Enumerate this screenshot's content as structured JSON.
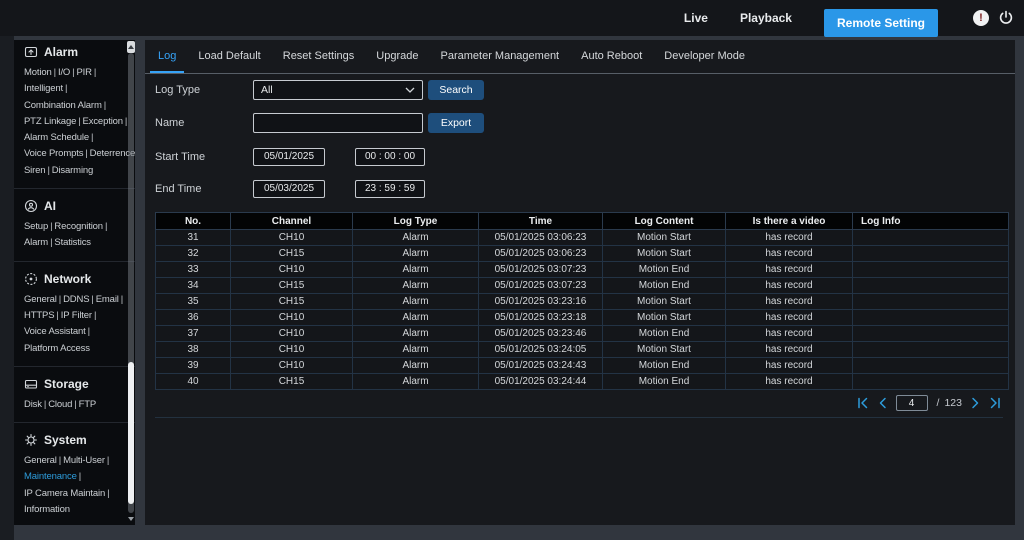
{
  "topbar": {
    "live": "Live",
    "playback": "Playback",
    "remote_setting": "Remote Setting",
    "alert_glyph": "!",
    "icons": [
      "alert-icon",
      "power-icon"
    ]
  },
  "sidebar": {
    "separator": "|",
    "active_item": "Maintenance",
    "sections": [
      {
        "title": "Alarm",
        "icon": "alarm-icon",
        "lines": [
          [
            "Motion",
            "I/O",
            "PIR"
          ],
          [
            "Intelligent"
          ],
          [
            "Combination Alarm"
          ],
          [
            "PTZ Linkage",
            "Exception"
          ],
          [
            "Alarm Schedule"
          ],
          [
            "Voice Prompts",
            "Deterrence"
          ],
          [
            "Siren",
            "Disarming"
          ]
        ]
      },
      {
        "title": "AI",
        "icon": "ai-icon",
        "lines": [
          [
            "Setup",
            "Recognition"
          ],
          [
            "Alarm",
            "Statistics"
          ]
        ]
      },
      {
        "title": "Network",
        "icon": "network-icon",
        "lines": [
          [
            "General",
            "DDNS",
            "Email"
          ],
          [
            "HTTPS",
            "IP Filter"
          ],
          [
            "Voice Assistant"
          ],
          [
            "Platform Access"
          ]
        ]
      },
      {
        "title": "Storage",
        "icon": "storage-icon",
        "lines": [
          [
            "Disk",
            "Cloud",
            "FTP"
          ]
        ]
      },
      {
        "title": "System",
        "icon": "system-icon",
        "lines": [
          [
            "General",
            "Multi-User"
          ],
          [
            "Maintenance"
          ],
          [
            "IP Camera Maintain"
          ],
          [
            "Information"
          ]
        ]
      }
    ]
  },
  "tabs": [
    {
      "label": "Log",
      "active": true
    },
    {
      "label": "Load Default",
      "active": false
    },
    {
      "label": "Reset Settings",
      "active": false
    },
    {
      "label": "Upgrade",
      "active": false
    },
    {
      "label": "Parameter Management",
      "active": false
    },
    {
      "label": "Auto Reboot",
      "active": false
    },
    {
      "label": "Developer Mode",
      "active": false
    }
  ],
  "filters": {
    "log_type_label": "Log Type",
    "log_type_value": "All",
    "search_button": "Search",
    "name_label": "Name",
    "name_value": "",
    "export_button": "Export",
    "start_time_label": "Start Time",
    "start_date": "05/01/2025",
    "start_time": "00 : 00 : 00",
    "end_time_label": "End Time",
    "end_date": "05/03/2025",
    "end_time": "23 : 59 : 59"
  },
  "log_table": {
    "columns": [
      "No.",
      "Channel",
      "Log Type",
      "Time",
      "Log Content",
      "Is there a video",
      "Log Info"
    ],
    "rows": [
      [
        "31",
        "CH10",
        "Alarm",
        "05/01/2025 03:06:23",
        "Motion Start",
        "has record",
        ""
      ],
      [
        "32",
        "CH15",
        "Alarm",
        "05/01/2025 03:06:23",
        "Motion Start",
        "has record",
        ""
      ],
      [
        "33",
        "CH10",
        "Alarm",
        "05/01/2025 03:07:23",
        "Motion End",
        "has record",
        ""
      ],
      [
        "34",
        "CH15",
        "Alarm",
        "05/01/2025 03:07:23",
        "Motion End",
        "has record",
        ""
      ],
      [
        "35",
        "CH15",
        "Alarm",
        "05/01/2025 03:23:16",
        "Motion Start",
        "has record",
        ""
      ],
      [
        "36",
        "CH10",
        "Alarm",
        "05/01/2025 03:23:18",
        "Motion Start",
        "has record",
        ""
      ],
      [
        "37",
        "CH10",
        "Alarm",
        "05/01/2025 03:23:46",
        "Motion End",
        "has record",
        ""
      ],
      [
        "38",
        "CH10",
        "Alarm",
        "05/01/2025 03:24:05",
        "Motion Start",
        "has record",
        ""
      ],
      [
        "39",
        "CH10",
        "Alarm",
        "05/01/2025 03:24:43",
        "Motion End",
        "has record",
        ""
      ],
      [
        "40",
        "CH15",
        "Alarm",
        "05/01/2025 03:24:44",
        "Motion End",
        "has record",
        ""
      ]
    ]
  },
  "pagination": {
    "current_page": "4",
    "separator": "/",
    "total_pages": "123",
    "icons": [
      "first-page-icon",
      "prev-page-icon",
      "next-page-icon",
      "last-page-icon"
    ]
  },
  "colors": {
    "accent_blue": "#2a97e8",
    "link_blue": "#2d9cdb",
    "tab_active_blue": "#36a3f7",
    "button_dark_blue": "#1e4e7c",
    "topbar_bg": "#14161a",
    "sidebar_bg": "#0a0c0f",
    "panel_bg": "#17191d",
    "table_header_bg": "#030405",
    "table_border": "#233345"
  }
}
